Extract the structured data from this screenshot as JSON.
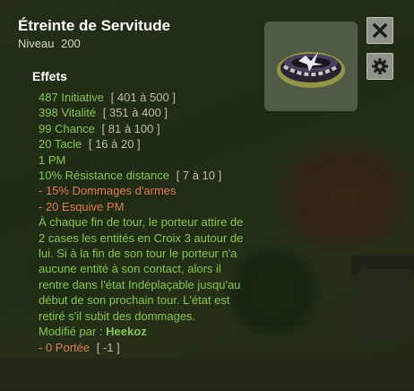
{
  "item": {
    "name": "Étreinte de Servitude",
    "level_label": "Niveau",
    "level": "200",
    "icon": "chain-collar-icon"
  },
  "buttons": {
    "close_icon": "close-icon",
    "settings_icon": "gear-icon"
  },
  "effects": {
    "title": "Effets",
    "lines": [
      {
        "value": "487",
        "stat": "Initiative",
        "range": "[ 401 à 500 ]"
      },
      {
        "value": "398",
        "stat": "Vitalité",
        "range": "[ 351 à 400 ]"
      },
      {
        "value": "99",
        "stat": "Chance",
        "range": "[ 81 à 100 ]"
      },
      {
        "value": "20",
        "stat": "Tacle",
        "range": "[ 16 à 20 ]"
      },
      {
        "value": "1",
        "stat": "PM",
        "range": ""
      },
      {
        "value": "10%",
        "stat": "Résistance distance",
        "range": "[ 7 à 10 ]"
      },
      {
        "value": "- 15%",
        "stat": "Dommages d'armes",
        "range": ""
      },
      {
        "value": "- 20",
        "stat": "Esquive PM",
        "range": ""
      }
    ],
    "description": "À chaque fin de tour, le porteur attire de 2 cases les entités en Croix 3 autour de lui. Si à la fin de son tour le porteur n'a aucune entité à son contact, alors il rentre dans l'état Indéplaçable jusqu'au début de son prochain tour. L'état est retiré s'il subit des dommages.",
    "modified_label": "Modifié par :",
    "modified_by": "Heekoz",
    "last_line": {
      "value": "- 0",
      "stat": "Portée",
      "range": "[ -1 ]"
    }
  },
  "colors": {
    "positive": "#88c456",
    "negative": "#e07a5a",
    "range": "#bcbcb0"
  }
}
